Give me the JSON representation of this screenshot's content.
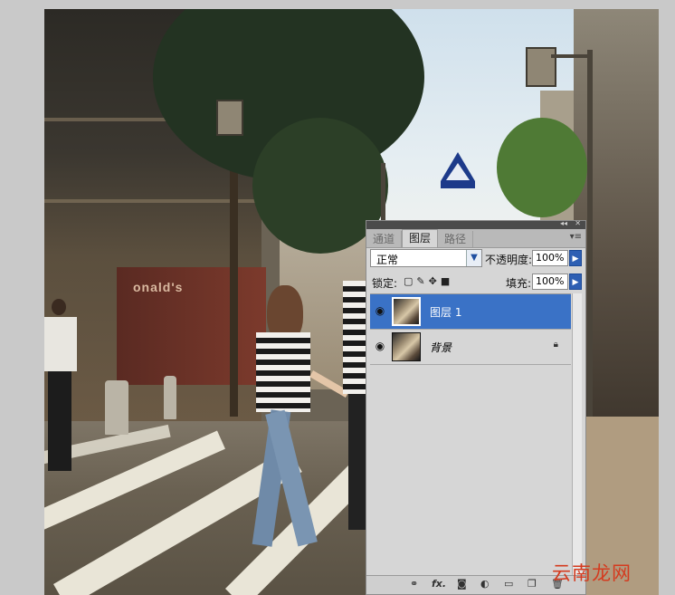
{
  "panel": {
    "tabs": [
      {
        "label": "通道",
        "active": false
      },
      {
        "label": "图层",
        "active": true
      },
      {
        "label": "路径",
        "active": false
      }
    ],
    "collapse_glyph": "◂◂",
    "close_glyph": "✕",
    "menu_glyph": "▾≡",
    "blend_mode": "正常",
    "opacity_label": "不透明度:",
    "opacity_value": "100%",
    "lock_label": "锁定:",
    "fill_label": "填充:",
    "fill_value": "100%",
    "layers": [
      {
        "name": "图层 1",
        "selected": true,
        "visible": true
      },
      {
        "name": "背景",
        "selected": false,
        "visible": true,
        "locked": true
      }
    ],
    "bottom_icons": [
      "link-layers-icon",
      "fx-icon",
      "mask-icon",
      "adjustment-icon",
      "group-icon",
      "new-layer-icon",
      "trash-icon"
    ],
    "fx_label": "fx."
  },
  "photo": {
    "storefront_text": "onald's"
  },
  "watermark": "云南龙网",
  "colors": {
    "selection": "#3a72c6",
    "panel_bg": "#d6d6d6",
    "watermark": "#d43b1f"
  }
}
